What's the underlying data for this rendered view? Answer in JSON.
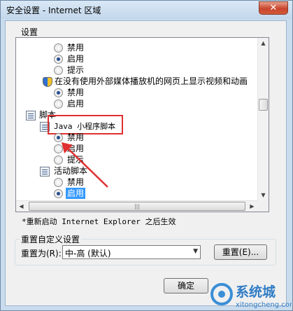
{
  "window": {
    "title": "安全设置 - Internet 区域",
    "close": "✕"
  },
  "settings_group": {
    "label": "设置"
  },
  "tree": {
    "rows": [
      {
        "type": "radio",
        "label": "禁用",
        "checked": false
      },
      {
        "type": "radio",
        "label": "启用",
        "checked": true
      },
      {
        "type": "radio",
        "label": "提示",
        "checked": false
      },
      {
        "type": "header",
        "icon": "security-shield-icon",
        "label": "在没有使用外部媒体播放机的网页上显示视频和动画"
      },
      {
        "type": "radio",
        "label": "禁用",
        "checked": true
      },
      {
        "type": "radio",
        "label": "启用",
        "checked": false
      },
      {
        "type": "category",
        "icon": "script-icon",
        "label": "脚本"
      },
      {
        "type": "header",
        "icon": "script-icon",
        "label": "Java 小程序脚本"
      },
      {
        "type": "radio",
        "label": "禁用",
        "checked": true
      },
      {
        "type": "radio",
        "label": "启用",
        "checked": false
      },
      {
        "type": "radio",
        "label": "提示",
        "checked": false
      },
      {
        "type": "header",
        "icon": "script-icon",
        "label": "活动脚本"
      },
      {
        "type": "radio",
        "label": "禁用",
        "checked": false
      },
      {
        "type": "radio",
        "label": "启用",
        "checked": true,
        "selected": true
      }
    ]
  },
  "restart_note": "*重新启动 Internet Explorer 之后生效",
  "reset_group": {
    "label": "重置自定义设置",
    "reset_to_label": "重置为(R):",
    "combo_value": "中-高 (默认)",
    "reset_button": "重置(E)..."
  },
  "ok_button": "确定",
  "watermark": {
    "brand": "系统城",
    "url": "xitongcheng.com"
  },
  "colors": {
    "annotation_red": "#e03030",
    "selection_blue": "#3399ff"
  }
}
